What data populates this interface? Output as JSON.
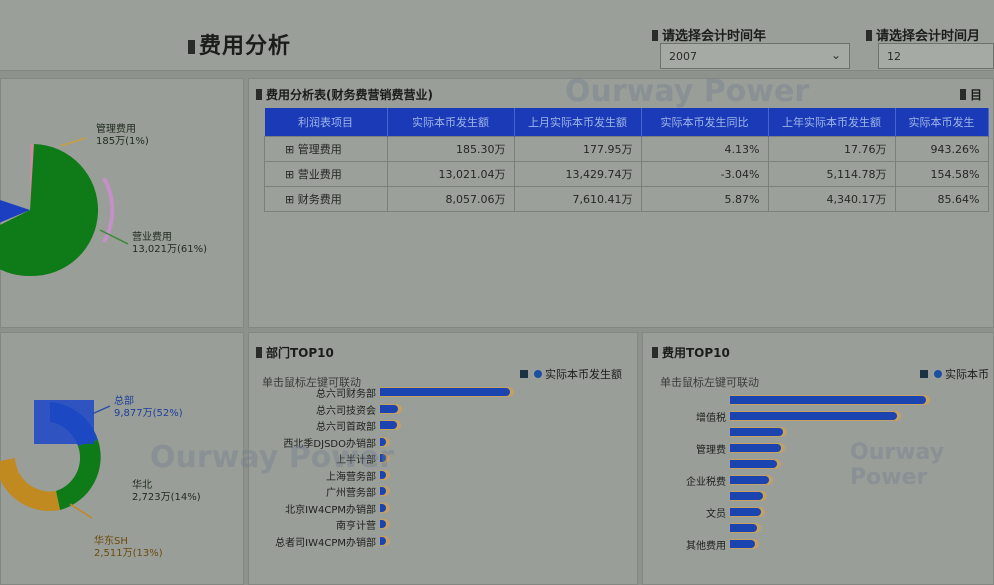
{
  "header": {
    "title": "费用分析",
    "filters": [
      {
        "label": "请选择会计时间年",
        "value": "2007"
      },
      {
        "label": "请选择会计时间月",
        "value": "12"
      }
    ]
  },
  "main_table": {
    "title": "费用分析表(财务费营销费营业)",
    "columns": [
      "利润表项目",
      "实际本币发生额",
      "上月实际本币发生额",
      "实际本币发生同比",
      "上年实际本币发生额",
      "实际本币发生"
    ],
    "rows": [
      {
        "name": "管理费用",
        "cells": [
          "185.30万",
          "177.95万",
          "4.13%",
          "17.76万",
          "943.26%"
        ]
      },
      {
        "name": "营业费用",
        "cells": [
          "13,021.04万",
          "13,429.74万",
          "-3.04%",
          "5,114.78万",
          "154.58%"
        ]
      },
      {
        "name": "财务费用",
        "cells": [
          "8,057.06万",
          "7,610.41万",
          "5.87%",
          "4,340.17万",
          "85.64%"
        ]
      }
    ],
    "corner_label": "目"
  },
  "pie_top": {
    "labels": [
      {
        "name": "管理费用",
        "value": "185万(1%)"
      },
      {
        "name": "营业费用",
        "value": "13,021万(61%)"
      }
    ],
    "colors": [
      "#0f7a18",
      "#1b3fc0",
      "#c78da0"
    ]
  },
  "ring_bottom": {
    "labels": [
      {
        "name": "总部",
        "value": "9,877万(52%)"
      },
      {
        "name": "华北",
        "value": "2,723万(14%)"
      },
      {
        "name": "华东SH",
        "value": "2,511万(13%)"
      }
    ],
    "colors": [
      "#1b4fb0",
      "#0f7a18",
      "#c08a20"
    ]
  },
  "dept_top10": {
    "title": "部门TOP10",
    "hint": "单击鼠标左键可联动",
    "legend": "实际本币发生额",
    "categories": [
      "总六司财务部",
      "总六司技资会",
      "总六司首政部",
      "西北季DJSDO办销部",
      "上半计部",
      "上海营务部",
      "广州营务部",
      "北京IW4CPM办销部",
      "南亨计营",
      "总者司IW4CPM办销部"
    ],
    "values": [
      9900,
      1350,
      1300,
      450,
      420,
      400,
      390,
      380,
      360,
      340
    ]
  },
  "fee_top10": {
    "title": "费用TOP10",
    "hint": "单击鼠标左键可联动",
    "legend": "实际本币",
    "categories": [
      "",
      "增值税",
      "",
      "管理费",
      "",
      "企业税费",
      "",
      "文员",
      "",
      "其他费用"
    ],
    "values": [
      9600,
      8200,
      2600,
      2500,
      2300,
      1900,
      1600,
      1500,
      1300,
      1200
    ]
  },
  "watermark": "Ourway Power"
}
